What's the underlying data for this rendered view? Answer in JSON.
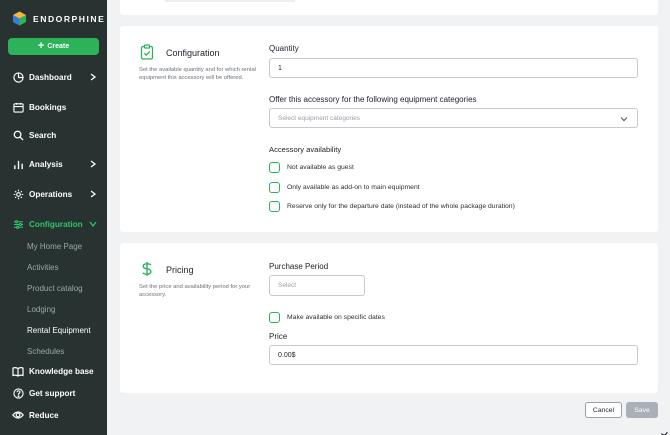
{
  "brand": {
    "name": "ENDORPHINE",
    "logo_icon": "endorphine-logo-icon"
  },
  "sidebar": {
    "create_label": "Create",
    "nav": [
      {
        "label": "Dashboard",
        "icon": "pie-chart-icon",
        "has_chevron": true
      },
      {
        "label": "Bookings",
        "icon": "calendar-icon",
        "has_chevron": false
      },
      {
        "label": "Search",
        "icon": "search-icon",
        "has_chevron": false
      },
      {
        "label": "Analysis",
        "icon": "bar-chart-icon",
        "has_chevron": true
      },
      {
        "label": "Operations",
        "icon": "gear-icon",
        "has_chevron": true
      },
      {
        "label": "Configuration",
        "icon": "sliders-icon",
        "has_chevron": true,
        "active": true
      }
    ],
    "sub_items": [
      "My Home Page",
      "Activities",
      "Product catalog",
      "Lodging",
      "Rental Equipment",
      "Schedules"
    ],
    "bottom": [
      {
        "label": "Knowledge base",
        "icon": "book-icon"
      },
      {
        "label": "Get support",
        "icon": "help-circle-icon"
      },
      {
        "label": "Reduce",
        "icon": "eye-icon"
      }
    ],
    "active_color": "#2ec566",
    "background": "#273231"
  },
  "configuration": {
    "title": "Configuration",
    "description": "Set the available quantity and for which rental equipment this accessory will be offered.",
    "icon": "clipboard-check-icon",
    "quantity_label": "Quantity",
    "quantity_value": "1",
    "categories_label": "Offer this accessory for the following equipment categories",
    "categories_placeholder": "Select equipment categories",
    "availability_label": "Accessory availability",
    "availability_options": [
      "Not available as guest",
      "Only available as add-on to main equipment",
      "Reserve only for the departure date (instead of the whole package duration)"
    ]
  },
  "pricing": {
    "title": "Pricing",
    "description": "Set the price and availability period for your accessory.",
    "icon": "dollar-icon",
    "period_label": "Purchase Period",
    "period_placeholder": "Select",
    "specific_dates_label": "Make available on specific dates",
    "price_label": "Price",
    "price_value": "0.00$"
  },
  "actions": {
    "cancel_label": "Cancel",
    "save_label": "Save"
  },
  "colors": {
    "accent": "#2cb35a",
    "save_disabled": "#a9b0b7"
  }
}
